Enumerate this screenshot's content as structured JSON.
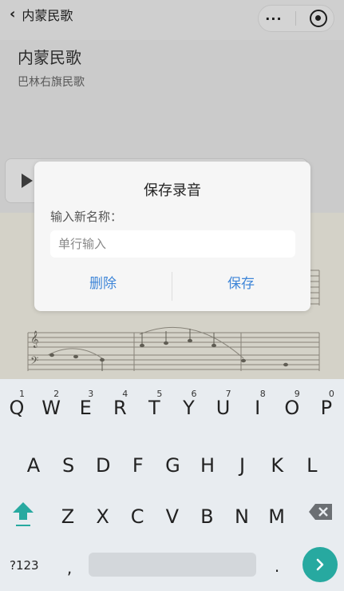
{
  "navbar": {
    "back_label": "内蒙民歌",
    "menu_label": "···"
  },
  "song": {
    "title": "内蒙民歌",
    "subtitle": "巴林右旗民歌"
  },
  "dialog": {
    "title": "保存录音",
    "label": "输入新名称：",
    "placeholder": "单行输入",
    "delete_label": "删除",
    "save_label": "保存"
  },
  "keyboard": {
    "row1": [
      {
        "k": "Q",
        "h": "1"
      },
      {
        "k": "W",
        "h": "2"
      },
      {
        "k": "E",
        "h": "3"
      },
      {
        "k": "R",
        "h": "4"
      },
      {
        "k": "T",
        "h": "5"
      },
      {
        "k": "Y",
        "h": "6"
      },
      {
        "k": "U",
        "h": "7"
      },
      {
        "k": "I",
        "h": "8"
      },
      {
        "k": "O",
        "h": "9"
      },
      {
        "k": "P",
        "h": "0"
      }
    ],
    "row2": [
      "A",
      "S",
      "D",
      "F",
      "G",
      "H",
      "J",
      "K",
      "L"
    ],
    "row3": [
      "Z",
      "X",
      "C",
      "V",
      "B",
      "N",
      "M"
    ],
    "sym_label": "?123",
    "comma": ",",
    "period": "."
  },
  "colors": {
    "accent": "#3f86d8",
    "enter": "#27a9a0",
    "shift": "#27a9a0"
  }
}
